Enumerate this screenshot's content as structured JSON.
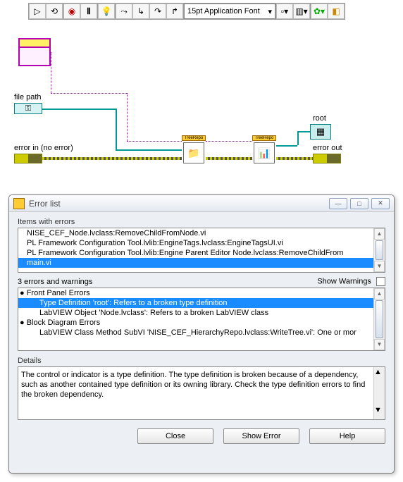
{
  "toolbar": {
    "font_label": "15pt Application Font"
  },
  "diagram": {
    "labels": {
      "file_path": "file path",
      "error_in": "error in (no error)",
      "root": "root",
      "error_out": "error out"
    },
    "subvi_tag": "TreeRepo"
  },
  "errwin": {
    "title": "Error list",
    "sections": {
      "items_label": "Items with errors",
      "count_label": "3 errors and warnings",
      "show_warnings_label": "Show Warnings",
      "details_label": "Details"
    },
    "items": [
      "NISE_CEF_Node.lvclass:RemoveChildFromNode.vi",
      "PL Framework Configuration Tool.lvlib:EngineTags.lvclass:EngineTagsUI.vi",
      "PL Framework Configuration Tool.lvlib:Engine Parent Editor Node.lvclass:RemoveChildFrom",
      "main.vi"
    ],
    "items_selected_index": 3,
    "errors": [
      {
        "bullet": true,
        "indent": 0,
        "text": "Front Panel Errors"
      },
      {
        "bullet": false,
        "indent": 1,
        "text": "Type Definition 'root': Refers to a broken type definition",
        "selected": true
      },
      {
        "bullet": false,
        "indent": 1,
        "text": "LabVIEW Object 'Node.lvclass': Refers to a broken LabVIEW class"
      },
      {
        "bullet": true,
        "indent": 0,
        "text": "Block Diagram Errors"
      },
      {
        "bullet": false,
        "indent": 1,
        "text": "LabVIEW Class Method SubVI 'NISE_CEF_HierarchyRepo.lvclass:WriteTree.vi': One or mor"
      }
    ],
    "details_text": "The control or indicator is a type definition. The type definition is broken because of a dependency, such as another contained type definition or its owning library. Check the type definition errors to find the broken dependency.",
    "buttons": {
      "close": "Close",
      "show_error": "Show Error",
      "help": "Help"
    }
  }
}
